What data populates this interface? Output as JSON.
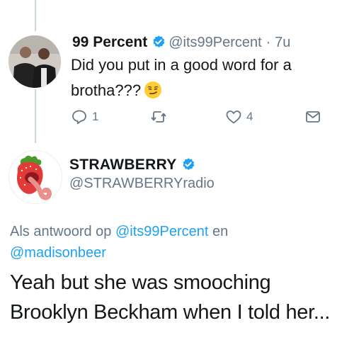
{
  "tweet1": {
    "name": "99 Percent",
    "handle": "@its99Percent",
    "separator": "·",
    "time": "7u",
    "text": "Did you put in a good word for a brotha???",
    "emoji": "smirk-emoji",
    "reply_count": "1",
    "like_count": "4"
  },
  "tweet2": {
    "name": "STRAWBERRY",
    "handle": "@STRAWBERRYradio",
    "reply_prefix": "Als antwoord op",
    "reply_mention_1": "@its99Percent",
    "reply_joiner": "en",
    "reply_mention_2": "@madisonbeer",
    "text": "Yeah but she was smooching Brooklyn Beckham when I told her..."
  },
  "colors": {
    "verified": "#1da1f2",
    "mention": "#1da1f2",
    "muted": "#657786",
    "thread_line": "#ccd6dd"
  },
  "icons": [
    "reply-icon",
    "retweet-icon",
    "heart-icon",
    "message-icon",
    "verified-badge-icon"
  ]
}
